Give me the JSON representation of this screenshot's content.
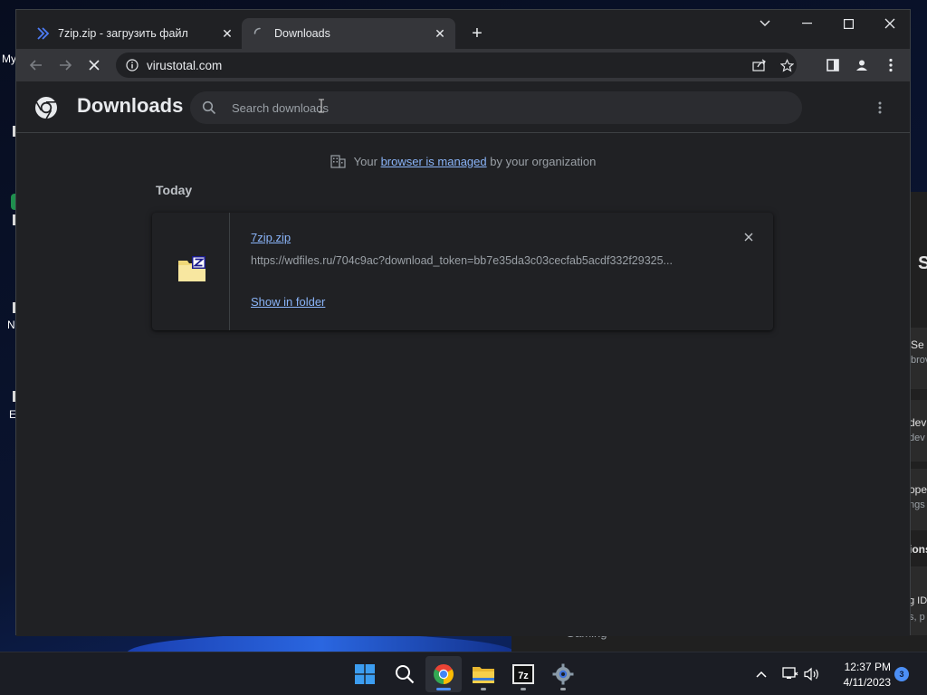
{
  "desktop": {
    "icon_labels": [
      "My",
      "N",
      "E"
    ],
    "background_window": {
      "texts": [
        "S",
        "Se",
        "brov",
        "dev",
        "dev",
        "ope",
        "ngs",
        "ions",
        "g ID",
        "s, p"
      ],
      "strip_text": "Gaming"
    }
  },
  "browser": {
    "tabs": [
      {
        "title": "7zip.zip - загрузить файл",
        "favicon": "virustotal-icon"
      },
      {
        "title": "Downloads",
        "favicon": "loading-spinner-icon"
      }
    ],
    "address": "virustotal.com"
  },
  "downloads_page": {
    "title": "Downloads",
    "search_placeholder": "Search downloads",
    "managed_notice": {
      "prefix": "Your",
      "link": "browser is managed",
      "suffix": "by your organization"
    },
    "sections": [
      {
        "date": "Today",
        "items": [
          {
            "file_name": "7zip.zip",
            "url": "https://wdfiles.ru/704c9ac?download_token=bb7e35da3c03cecfab5acdf332f29325...",
            "action": "Show in folder"
          }
        ]
      }
    ]
  },
  "taskbar": {
    "apps": [
      "windows-start",
      "search",
      "chrome",
      "file-explorer",
      "7zip",
      "settings"
    ],
    "time": "12:37 PM",
    "date": "4/11/2023",
    "notification_count": "3"
  },
  "colors": {
    "link": "#8ab4f8",
    "page_bg": "#202124",
    "toolbar_bg": "#35363a"
  }
}
